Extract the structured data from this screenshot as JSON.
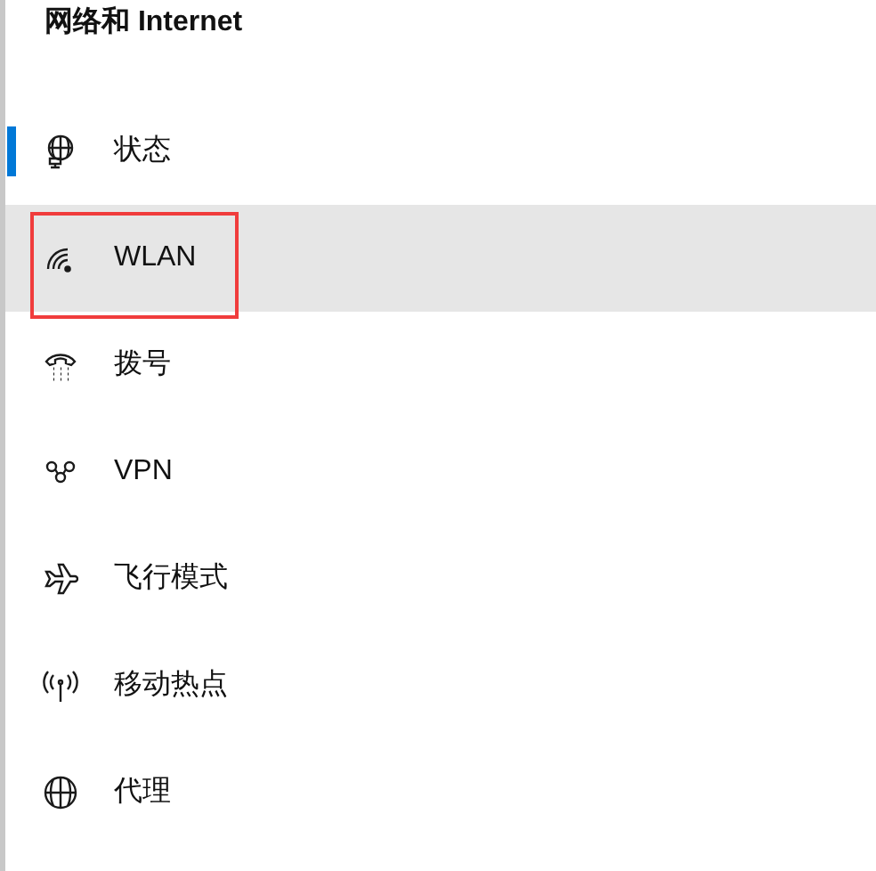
{
  "title": "网络和 Internet",
  "items": [
    {
      "label": "状态",
      "selected": true,
      "hovered": false,
      "highlighted": false
    },
    {
      "label": "WLAN",
      "selected": false,
      "hovered": true,
      "highlighted": true
    },
    {
      "label": "拨号",
      "selected": false,
      "hovered": false,
      "highlighted": false
    },
    {
      "label": "VPN",
      "selected": false,
      "hovered": false,
      "highlighted": false
    },
    {
      "label": "飞行模式",
      "selected": false,
      "hovered": false,
      "highlighted": false
    },
    {
      "label": "移动热点",
      "selected": false,
      "hovered": false,
      "highlighted": false
    },
    {
      "label": "代理",
      "selected": false,
      "hovered": false,
      "highlighted": false
    }
  ]
}
